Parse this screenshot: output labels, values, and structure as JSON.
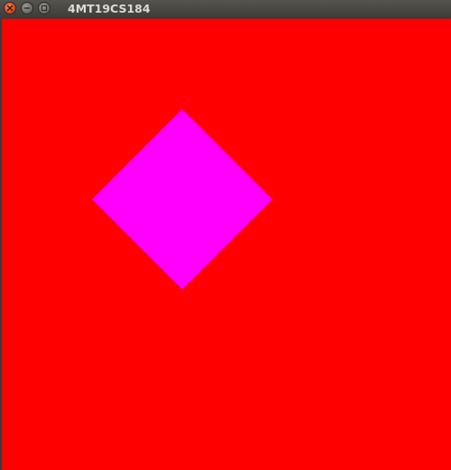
{
  "window": {
    "title": "4MT19CS184",
    "buttons": {
      "close_icon": "close-icon",
      "minimize_icon": "minimize-icon",
      "maximize_icon": "maximize-icon"
    }
  },
  "scene": {
    "background_color": "#ff0000",
    "shape": {
      "type": "diamond",
      "fill_color": "#ff00ff"
    }
  }
}
